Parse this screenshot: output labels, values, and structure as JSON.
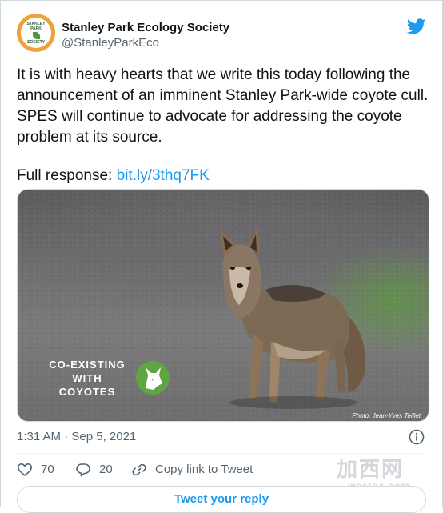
{
  "author": {
    "display_name": "Stanley Park Ecology Society",
    "handle": "@StanleyParkEco",
    "avatar_text": "STANLEY PARK ECOLOGY SOCIETY",
    "brand_color": "#f0a13a"
  },
  "tweet": {
    "text": "It is with heavy hearts that we write this today following the announcement of an imminent Stanley Park-wide coyote cull. SPES will continue to advocate for addressing the coyote problem at its source.",
    "response_prefix": "Full response: ",
    "link": "bit.ly/3thq7FK"
  },
  "media": {
    "overlay_line1": "CO-EXISTING",
    "overlay_line2": "WITH",
    "overlay_line3": "COYOTES",
    "photo_credit": "Photo: Jean-Yves Teillet"
  },
  "meta": {
    "timestamp": "1:31 AM · Sep 5, 2021",
    "info_icon": "info-icon"
  },
  "actions": {
    "likes": "70",
    "replies": "20",
    "copy_link": "Copy link to Tweet"
  },
  "reply_button": "Tweet your reply",
  "watermark": {
    "text": "加西网",
    "url": "westca.com"
  },
  "colors": {
    "accent": "#1d9bf0",
    "secondary_text": "#536471",
    "border": "#cfd9de"
  }
}
